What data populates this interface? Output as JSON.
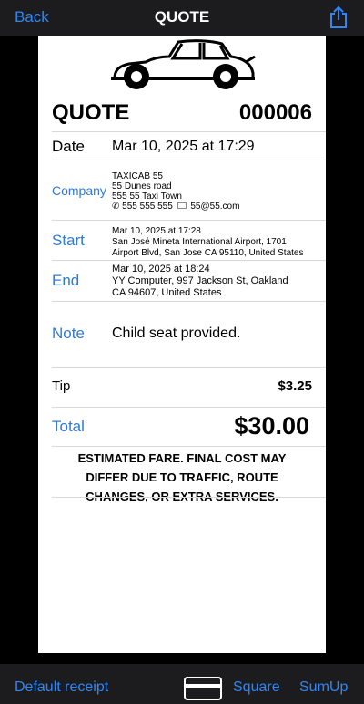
{
  "nav": {
    "back": "Back",
    "title": "QUOTE"
  },
  "receipt": {
    "heading": "QUOTE",
    "number": "000006",
    "date_label": "Date",
    "date_value": "Mar 10, 2025 at 17:29",
    "company_label": "Company",
    "company": {
      "name": "TAXICAB 55",
      "address1": "55 Dunes road",
      "address2": "555 55 Taxi Town",
      "phone_icon": "✆",
      "phone": "555 555 555",
      "email_icon": "mail-icon",
      "email": "55@55.com"
    },
    "start_label": "Start",
    "start": {
      "time": "Mar 10, 2025 at 17:28",
      "address1": "San José Mineta International Airport, 1701",
      "address2": "Airport Blvd, San Jose CA 95110, United States"
    },
    "end_label": "End",
    "end": {
      "time": "Mar 10, 2025 at 18:24",
      "address1": "YY Computer, 997 Jackson St, Oakland",
      "address2": "CA 94607, United States"
    },
    "note_label": "Note",
    "note_value": "Child seat provided.",
    "tip_label": "Tip",
    "tip_value": "$3.25",
    "total_label": "Total",
    "total_value": "$30.00",
    "disclaimer_1": "ESTIMATED FARE. FINAL COST MAY",
    "disclaimer_2": "DIFFER DUE TO TRAFFIC, ROUTE",
    "disclaimer_3": "CHANGES, OR EXTRA SERVICES."
  },
  "bottom": {
    "default_receipt": "Default receipt",
    "card_icon": "credit-card-icon",
    "square": "Square",
    "sumup": "SumUp"
  },
  "colors": {
    "accent": "#2f86f6",
    "label_blue": "#2f7ad6",
    "bar": "#1c1c1e"
  }
}
